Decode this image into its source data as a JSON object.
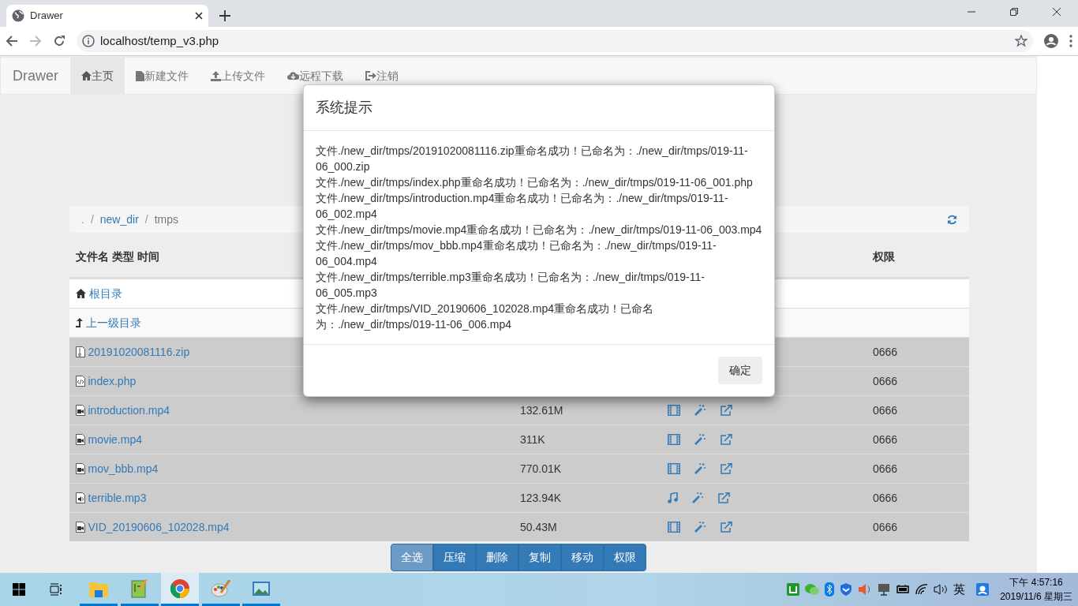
{
  "browser": {
    "tab_title": "Drawer",
    "url": "localhost/temp_v3.php",
    "forward_disabled": true
  },
  "navbar": {
    "brand": "Drawer",
    "items": [
      {
        "label": "主页",
        "selected": true
      },
      {
        "label": "新建文件",
        "selected": false
      },
      {
        "label": "上传文件",
        "selected": false
      },
      {
        "label": "远程下载",
        "selected": false
      },
      {
        "label": "注销",
        "selected": false
      }
    ]
  },
  "breadcrumb": {
    "separator": "/",
    "items": [
      ".",
      "new_dir",
      "tmps"
    ]
  },
  "table": {
    "columns": [
      "文件名 类型 时间",
      "权限"
    ],
    "nav_rows": [
      {
        "label": "根目录",
        "kind": "root"
      },
      {
        "label": "上一级目录",
        "kind": "up"
      }
    ],
    "rows": [
      {
        "name": "20191020081116.zip",
        "kind": "zip",
        "perm": "0666",
        "selected": true
      },
      {
        "name": "index.php",
        "kind": "code",
        "perm": "0666",
        "selected": true
      },
      {
        "name": "introduction.mp4",
        "kind": "video",
        "size": "132.61M",
        "perm": "0666",
        "selected": true
      },
      {
        "name": "movie.mp4",
        "kind": "video",
        "size": "311K",
        "perm": "0666",
        "selected": true
      },
      {
        "name": "mov_bbb.mp4",
        "kind": "video",
        "size": "770.01K",
        "perm": "0666",
        "selected": true
      },
      {
        "name": "terrible.mp3",
        "kind": "audio",
        "size": "123.94K",
        "perm": "0666",
        "selected": true
      },
      {
        "name": "VID_20190606_102028.mp4",
        "kind": "video",
        "size": "50.43M",
        "perm": "0666",
        "selected": true
      }
    ]
  },
  "bulk_actions": [
    {
      "label": "全选",
      "active": true
    },
    {
      "label": "压缩",
      "active": false
    },
    {
      "label": "删除",
      "active": false
    },
    {
      "label": "复制",
      "active": false
    },
    {
      "label": "移动",
      "active": false
    },
    {
      "label": "权限",
      "active": false
    }
  ],
  "modal": {
    "title": "系统提示",
    "messages": [
      "文件./new_dir/tmps/20191020081116.zip重命名成功！已命名为：./new_dir/tmps/019-11-06_000.zip",
      "文件./new_dir/tmps/index.php重命名成功！已命名为：./new_dir/tmps/019-11-06_001.php",
      "文件./new_dir/tmps/introduction.mp4重命名成功！已命名为：./new_dir/tmps/019-11-06_002.mp4",
      "文件./new_dir/tmps/movie.mp4重命名成功！已命名为：./new_dir/tmps/019-11-06_003.mp4",
      "文件./new_dir/tmps/mov_bbb.mp4重命名成功！已命名为：./new_dir/tmps/019-11-06_004.mp4",
      "文件./new_dir/tmps/terrible.mp3重命名成功！已命名为：./new_dir/tmps/019-11-06_005.mp3",
      "文件./new_dir/tmps/VID_20190606_102028.mp4重命名成功！已命名为：./new_dir/tmps/019-11-06_006.mp4"
    ],
    "button": "确定"
  },
  "taskbar": {
    "apps": [
      {
        "kind": "explorer",
        "selected": false
      },
      {
        "kind": "notepad",
        "selected": false
      },
      {
        "kind": "chrome",
        "selected": true
      },
      {
        "kind": "paint",
        "selected": false
      },
      {
        "kind": "photos",
        "selected": false
      }
    ],
    "ime": "英",
    "time": "下午 4:57:16",
    "date": "2019/11/6 星期三"
  }
}
